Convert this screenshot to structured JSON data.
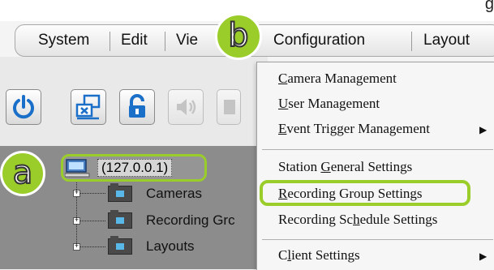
{
  "top_strip": {
    "text": "g"
  },
  "menubar": {
    "items": [
      "System",
      "Edit",
      "Vie",
      "Configuration",
      "Layout"
    ]
  },
  "toolbar": {
    "buttons": [
      {
        "icon": "power-icon",
        "color": "#1a6fc9",
        "enabled": true
      },
      {
        "icon": "network-icon",
        "color": "#1a6fc9",
        "enabled": true
      },
      {
        "icon": "lock-icon",
        "color": "#1a6fc9",
        "enabled": true
      },
      {
        "icon": "speaker-icon",
        "color": "#b0b0b0",
        "enabled": false
      },
      {
        "icon": "unknown-icon",
        "color": "#b0b0b0",
        "enabled": false
      }
    ]
  },
  "tree": {
    "server_label": "(127.0.0.1)",
    "children": [
      {
        "label": "Cameras",
        "expander": "+"
      },
      {
        "label": "Recording Grc",
        "expander": "+"
      },
      {
        "label": "Layouts",
        "expander": "+"
      }
    ]
  },
  "dropdown": {
    "items": [
      {
        "label": "Camera Management",
        "underline": "C",
        "has_submenu": false
      },
      {
        "label": "User Management",
        "underline": "U",
        "has_submenu": false
      },
      {
        "label": "Event Trigger Management",
        "underline": "E",
        "has_submenu": true
      },
      {
        "label": "Station General Settings",
        "underline": "G",
        "has_submenu": false
      },
      {
        "label": "Recording Group Settings",
        "underline": "R",
        "has_submenu": false
      },
      {
        "label": "Recording Schedule Settings",
        "underline": "h",
        "has_submenu": false
      },
      {
        "label": "Client Settings",
        "underline": "l",
        "has_submenu": true
      }
    ],
    "submenu_arrow": "▶"
  },
  "callouts": {
    "a": "a",
    "b": "b",
    "color": "#9acd2a"
  }
}
